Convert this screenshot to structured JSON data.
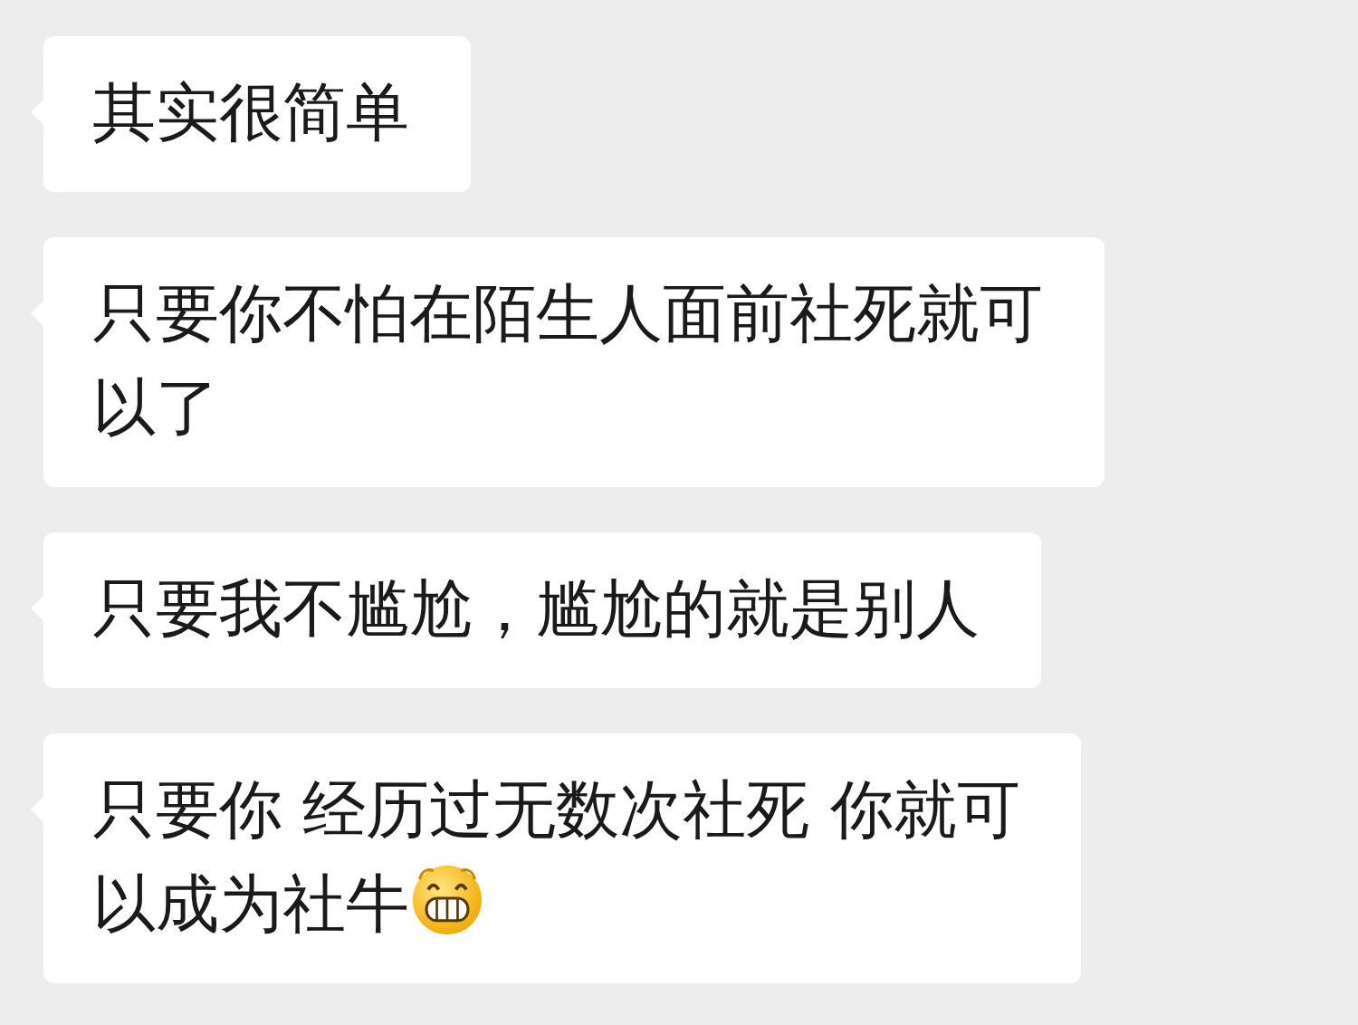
{
  "messages": [
    {
      "kind": "text",
      "lines": [
        "其实很简单"
      ]
    },
    {
      "kind": "text",
      "lines": [
        "只要你不怕在陌生人面前社死就可",
        "以了"
      ]
    },
    {
      "kind": "text",
      "lines": [
        "只要我不尴尬，尴尬的就是别人"
      ]
    },
    {
      "kind": "text_with_grin",
      "lines": [
        "只要你 经历过无数次社死 你就可",
        "以成为社牛"
      ]
    }
  ]
}
